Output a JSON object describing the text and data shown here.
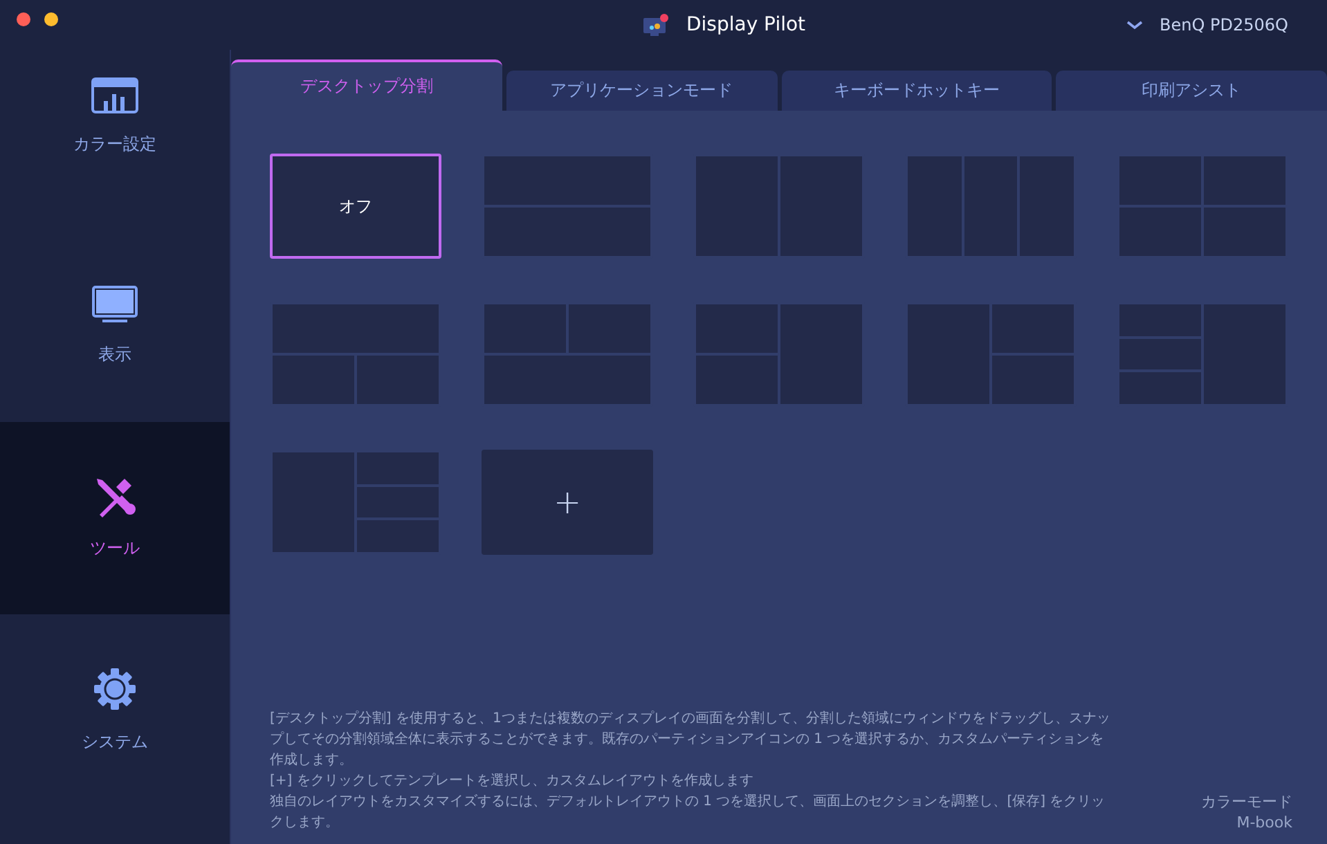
{
  "window": {
    "title": "Display Pilot",
    "monitor": "BenQ PD2506Q"
  },
  "sidebar": {
    "items": [
      {
        "label": "カラー設定",
        "kind": "chart",
        "selected": false
      },
      {
        "label": "表示",
        "kind": "monitor",
        "selected": false
      },
      {
        "label": "ツール",
        "kind": "tools",
        "selected": true
      },
      {
        "label": "システム",
        "kind": "gear",
        "selected": false
      }
    ]
  },
  "tabs": [
    {
      "label": "デスクトップ分割",
      "selected": true
    },
    {
      "label": "アプリケーションモード",
      "selected": false
    },
    {
      "label": "キーボードホットキー",
      "selected": false
    },
    {
      "label": "印刷アシスト",
      "selected": false
    }
  ],
  "layouts": [
    {
      "kind": "off",
      "label": "オフ",
      "selected": true
    },
    {
      "kind": "rows2",
      "selected": false
    },
    {
      "kind": "cols2",
      "selected": false
    },
    {
      "kind": "cols3",
      "selected": false
    },
    {
      "kind": "grid4",
      "selected": false
    },
    {
      "kind": "top1bottom2",
      "selected": false
    },
    {
      "kind": "top2bottom1",
      "selected": false
    },
    {
      "kind": "left2right1",
      "selected": false
    },
    {
      "kind": "left1right2",
      "selected": false
    },
    {
      "kind": "left3right1",
      "selected": false
    },
    {
      "kind": "left1right3",
      "selected": false
    },
    {
      "kind": "add",
      "label": "+",
      "selected": false
    }
  ],
  "description": [
    "[デスクトップ分割] を使用すると、1つまたは複数のディスプレイの画面を分割して、分割した領域にウィンドウをドラッグし、スナップしてその分割領域全体に表示することができます。既存のパーティションアイコンの 1 つを選択するか、カスタムパーティションを作成します。",
    "[+] をクリックしてテンプレートを選択し、カスタムレイアウトを作成します",
    "独自のレイアウトをカスタマイズするには、デフォルトレイアウトの 1 つを選択して、画面上のセクションを調整し、[保存] をクリックします。"
  ],
  "color_mode": {
    "label": "カラーモード",
    "value": "M-book"
  }
}
